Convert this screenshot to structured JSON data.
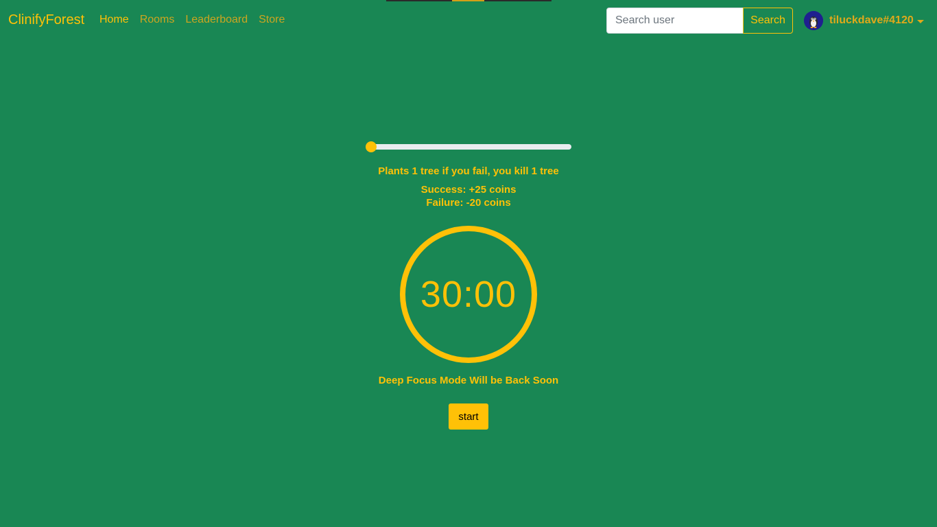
{
  "navbar": {
    "brand": "ClinifyForest",
    "links": [
      {
        "label": "Home"
      },
      {
        "label": "Rooms"
      },
      {
        "label": "Leaderboard"
      },
      {
        "label": "Store"
      }
    ],
    "search": {
      "placeholder": "Search user",
      "value": "",
      "button_label": "Search"
    },
    "user": {
      "username": "tiluckdave#4120",
      "avatar_icon": "penguin-avatar-icon"
    }
  },
  "main": {
    "slider": {
      "value_fraction": 0.0
    },
    "tree_info": "Plants 1 tree if you fail, you kill 1 tree",
    "success_text": "Success: +25 coins",
    "failure_text": "Failure: -20 coins",
    "timer": "30:00",
    "deep_focus_notice": "Deep Focus Mode Will be Back Soon",
    "start_label": "start"
  },
  "colors": {
    "background": "#198754",
    "accent": "#ffc107",
    "track": "#e9ecef"
  }
}
